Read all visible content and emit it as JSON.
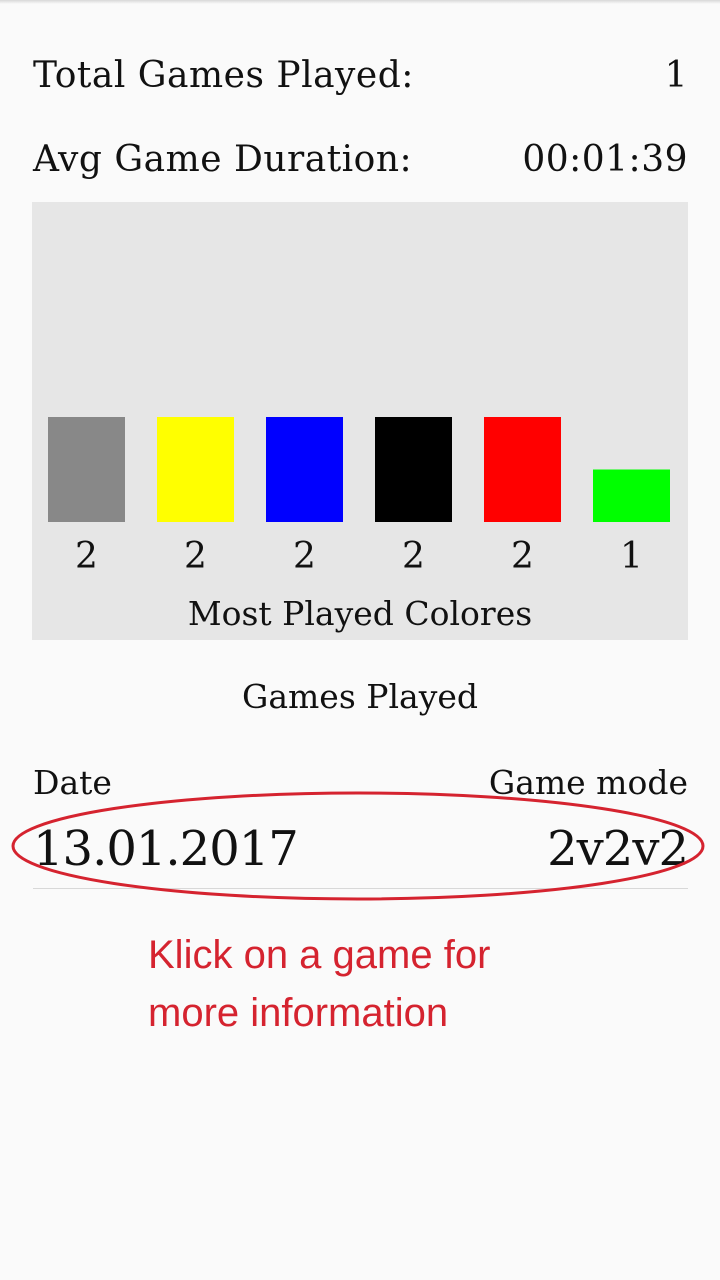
{
  "stats": {
    "total_label": "Total Games Played:",
    "total_value": "1",
    "avg_label": "Avg Game Duration:",
    "avg_value": "00:01:39"
  },
  "chart_data": {
    "type": "bar",
    "title": "Most Played Colores",
    "categories": [
      "gray",
      "yellow",
      "blue",
      "black",
      "red",
      "green"
    ],
    "values": [
      2,
      2,
      2,
      2,
      2,
      1
    ],
    "colors": [
      "#888888",
      "#ffff00",
      "#0000ff",
      "#000000",
      "#ff0000",
      "#00ff00"
    ],
    "value_labels": [
      "2",
      "2",
      "2",
      "2",
      "2",
      "1"
    ],
    "ylim": [
      0,
      2
    ],
    "grid": false,
    "xlabel": "",
    "ylabel": ""
  },
  "games": {
    "title": "Games Played",
    "header_date": "Date",
    "header_mode": "Game mode",
    "rows": [
      {
        "date": "13.01.2017",
        "mode": "2v2v2"
      }
    ]
  },
  "annotation": {
    "line1": "Klick on a game for",
    "line2": "more information",
    "color": "#d5232f"
  }
}
